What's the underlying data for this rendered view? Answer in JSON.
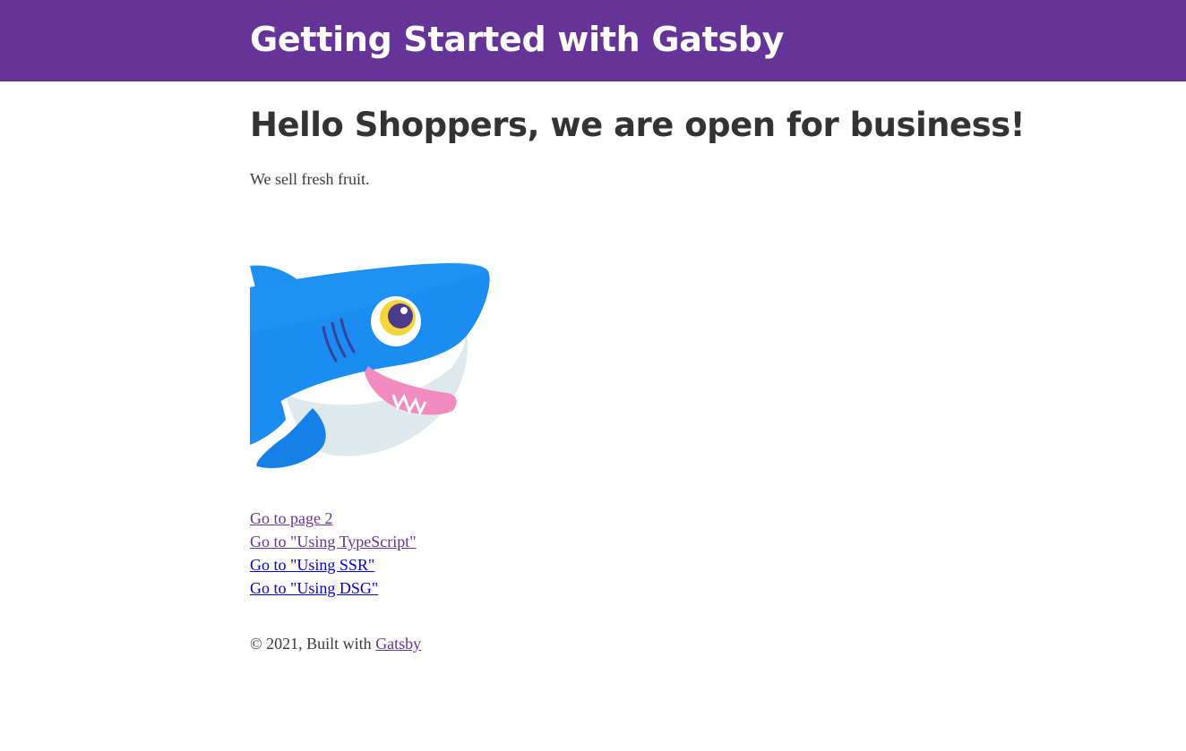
{
  "header": {
    "title": "Getting Started with Gatsby",
    "background_color": "#663399"
  },
  "main": {
    "heading": "Hello Shoppers, we are open for business!",
    "intro": "We sell fresh fruit.",
    "image": {
      "icon": "gatsby-astronaut-shark-icon"
    },
    "links": [
      {
        "label": "Go to page 2",
        "visited": true
      },
      {
        "label": "Go to \"Using TypeScript\"",
        "visited": true
      },
      {
        "label": "Go to \"Using SSR\"",
        "visited": false
      },
      {
        "label": "Go to \"Using DSG\"",
        "visited": false
      }
    ]
  },
  "footer": {
    "text": "© 2021, Built with",
    "link_label": "Gatsby"
  },
  "colors": {
    "visited_link": "#663399",
    "unvisited_link": "#0000ee"
  }
}
